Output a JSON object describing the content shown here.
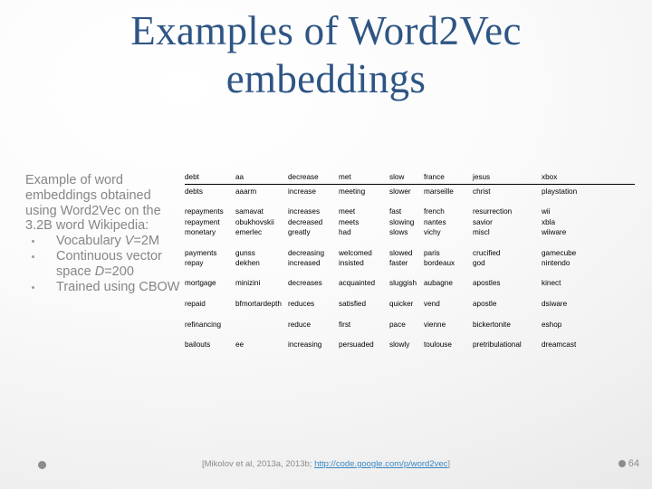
{
  "slide": {
    "title": "Examples of Word2Vec embeddings",
    "title_color": "#2e5584",
    "background_color": "#f2f2f2"
  },
  "body": {
    "intro": "Example of word embeddings obtained using Word2Vec on the 3.2B word Wikipedia:",
    "bullets": [
      {
        "text_before": "Vocabulary ",
        "symbol": "V",
        "text_after": "=2M"
      },
      {
        "text_before": "Continuous vector space ",
        "symbol": "D",
        "text_after": "=200"
      },
      {
        "text_before": "Trained using CBOW",
        "symbol": "",
        "text_after": ""
      }
    ]
  },
  "table": {
    "headers": [
      "debt",
      "aa",
      "decrease",
      "met",
      "slow",
      "france",
      "jesus",
      "xbox"
    ],
    "rows": [
      [
        "debts",
        "aaarm",
        "increase",
        "meeting",
        "slower",
        "marseille",
        "christ",
        "playstation"
      ],
      [
        "",
        "",
        "",
        "",
        "",
        "",
        "",
        ""
      ],
      [
        "repayments",
        "samavat",
        "increases",
        "meet",
        "fast",
        "french",
        "resurrection",
        "wii"
      ],
      [
        "repayment",
        "obukhovskii",
        "decreased",
        "meets",
        "slowing",
        "nantes",
        "savior",
        "xbla"
      ],
      [
        "monetary",
        "emerlec",
        "greatly",
        "had",
        "slows",
        "vichy",
        "miscl",
        "wiiware"
      ],
      [
        "",
        "",
        "",
        "",
        "",
        "",
        "",
        ""
      ],
      [
        "payments",
        "gunss",
        "decreasing",
        "welcomed",
        "slowed",
        "paris",
        "crucified",
        "gamecube"
      ],
      [
        "repay",
        "dekhen",
        "increased",
        "insisted",
        "faster",
        "bordeaux",
        "god",
        "nintendo"
      ],
      [
        "",
        "",
        "",
        "",
        "",
        "",
        "",
        ""
      ],
      [
        "mortgage",
        "minizini",
        "decreases",
        "acquainted",
        "sluggish",
        "aubagne",
        "apostles",
        "kinect"
      ],
      [
        "",
        "",
        "",
        "",
        "",
        "",
        "",
        ""
      ],
      [
        "repaid",
        "bfmortardepth",
        "reduces",
        "satisfied",
        "quicker",
        "vend",
        "apostle",
        "dsiware"
      ],
      [
        "refinancing",
        "",
        "reduce",
        "first",
        "pace",
        "vienne",
        "bickertonite",
        "eshop"
      ],
      [
        "",
        "",
        "",
        "",
        "",
        "",
        "",
        ""
      ],
      [
        "bailouts",
        "ee",
        "increasing",
        "persuaded",
        "slowly",
        "toulouse",
        "pretribulational",
        "dreamcast"
      ]
    ]
  },
  "footer": {
    "citation_prefix": "[Mikolov et al, 2013a, 2013b; ",
    "citation_link": "http://code.google.com/p/word2vec",
    "citation_suffix": "]",
    "page_number": "64"
  }
}
